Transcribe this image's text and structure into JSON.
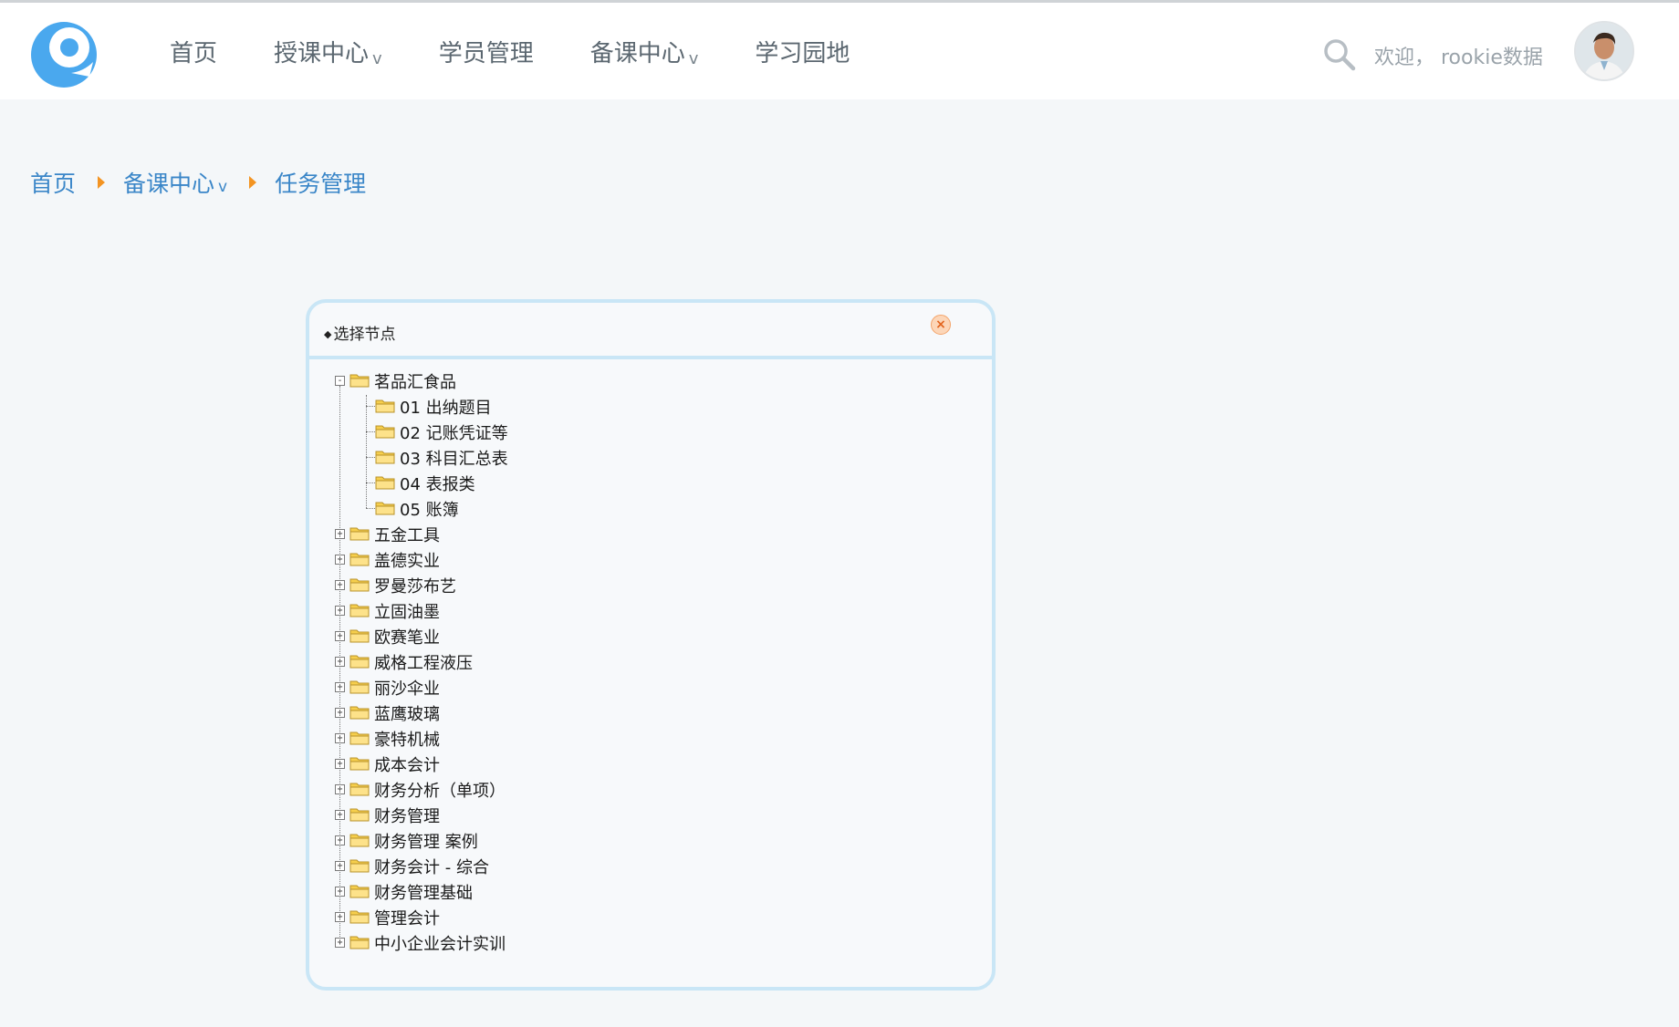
{
  "header": {
    "nav": [
      {
        "label": "首页",
        "has_dropdown": false
      },
      {
        "label": "授课中心",
        "has_dropdown": true
      },
      {
        "label": "学员管理",
        "has_dropdown": false
      },
      {
        "label": "备课中心",
        "has_dropdown": true
      },
      {
        "label": "学习园地",
        "has_dropdown": false
      }
    ],
    "dropdown_glyph": "v",
    "welcome": "欢迎， rookie数据",
    "search_icon": "search-icon",
    "avatar_icon": "user-avatar"
  },
  "breadcrumb": {
    "items": [
      "首页",
      "备课中心",
      "任务管理"
    ],
    "dropdown_glyph": "v",
    "separator_color": "#f39422"
  },
  "dialog": {
    "title": "选择节点",
    "title_bullet": "◆",
    "close_glyph": "×",
    "tree": [
      {
        "label": "茗品汇食品",
        "expanded": true,
        "children": [
          "01 出纳题目",
          "02 记账凭证等",
          "03 科目汇总表",
          "04 表报类",
          "05 账簿"
        ]
      },
      {
        "label": "五金工具",
        "expanded": false
      },
      {
        "label": "盖德实业",
        "expanded": false
      },
      {
        "label": "罗曼莎布艺",
        "expanded": false
      },
      {
        "label": "立固油墨",
        "expanded": false
      },
      {
        "label": "欧赛笔业",
        "expanded": false
      },
      {
        "label": "威格工程液压",
        "expanded": false
      },
      {
        "label": "丽沙伞业",
        "expanded": false
      },
      {
        "label": "蓝鹰玻璃",
        "expanded": false
      },
      {
        "label": "豪特机械",
        "expanded": false
      },
      {
        "label": "成本会计",
        "expanded": false
      },
      {
        "label": "财务分析（单项）",
        "expanded": false
      },
      {
        "label": "财务管理",
        "expanded": false
      },
      {
        "label": "财务管理 案例",
        "expanded": false
      },
      {
        "label": "财务会计 - 综合",
        "expanded": false
      },
      {
        "label": "财务管理基础",
        "expanded": false
      },
      {
        "label": "管理会计",
        "expanded": false
      },
      {
        "label": "中小企业会计实训",
        "expanded": false
      }
    ]
  },
  "colors": {
    "accent_blue": "#3a86c8",
    "logo_blue": "#4aa8ee",
    "dialog_border": "#c9e6f6",
    "folder_yellow": "#f6cf4d"
  }
}
